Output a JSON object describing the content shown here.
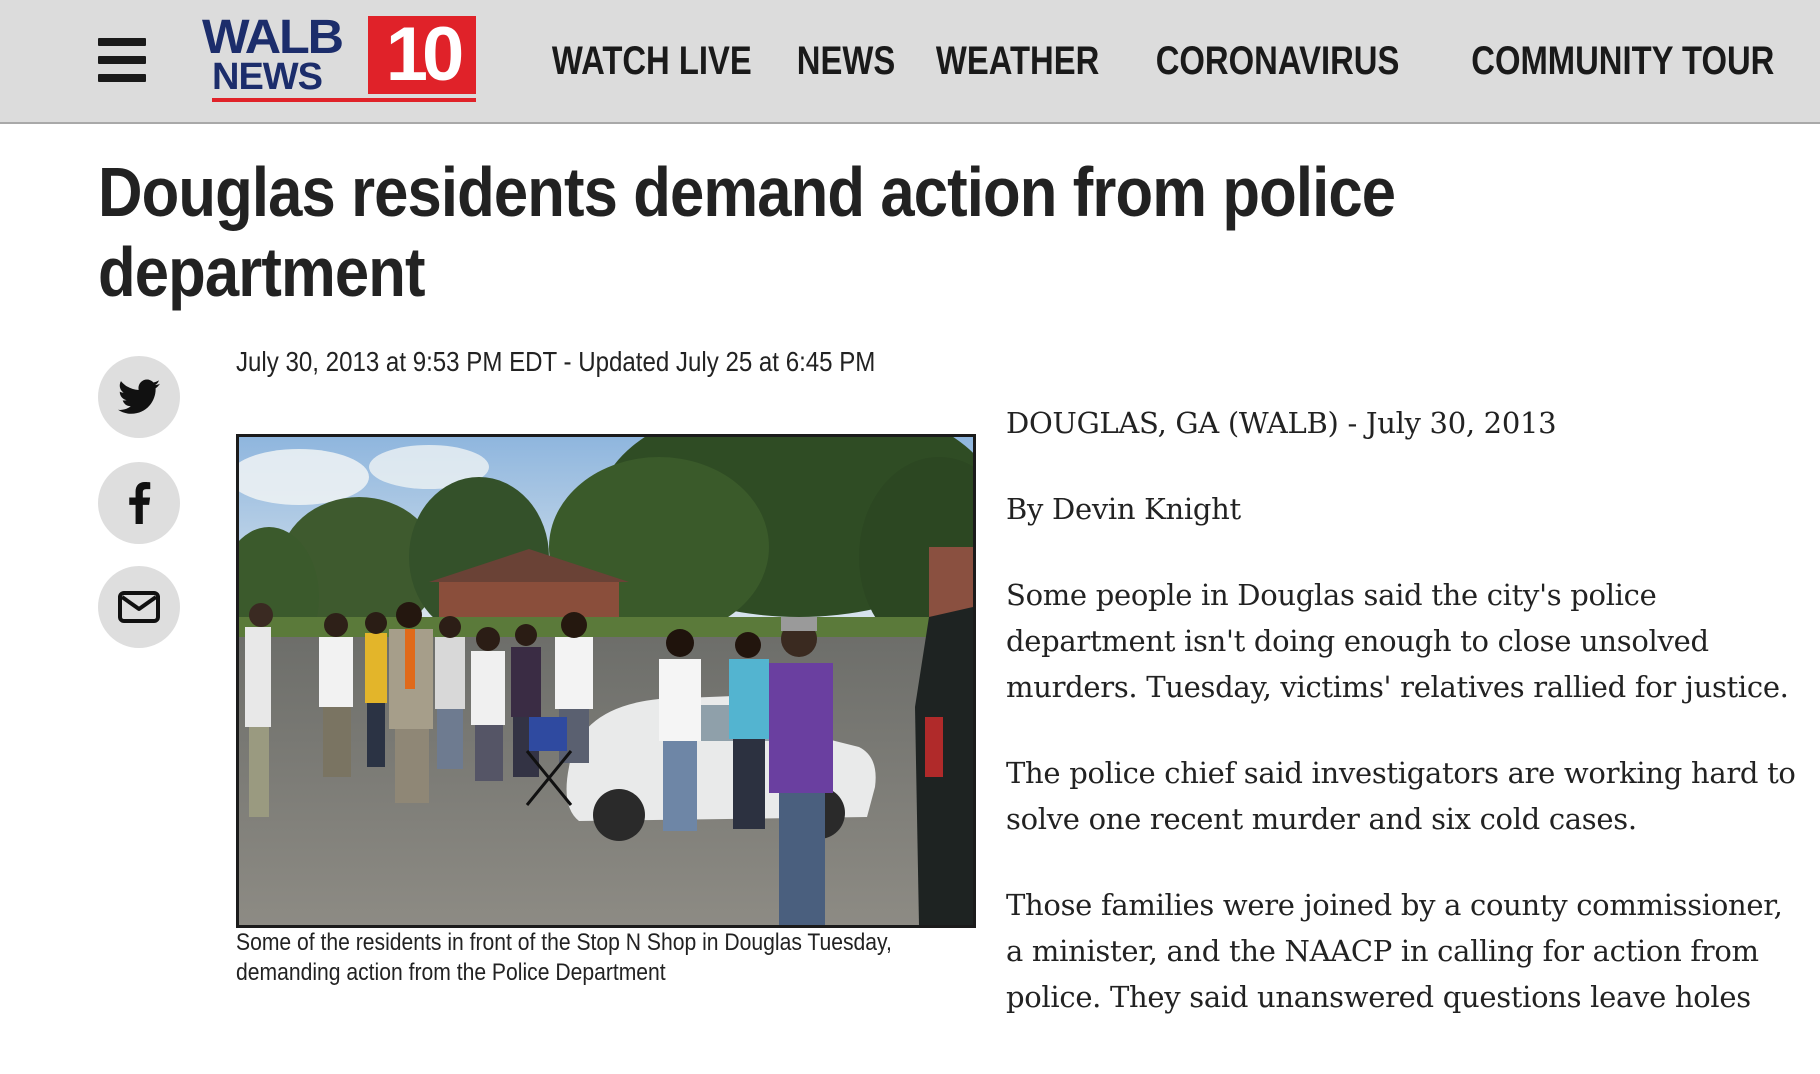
{
  "header": {
    "menu_icon": "hamburger-menu-icon",
    "logo": {
      "top_text": "WALB",
      "bottom_text": "NEWS",
      "number": "10",
      "colors": {
        "navy": "#1c2d6b",
        "red": "#e02229"
      }
    },
    "nav": [
      "WATCH LIVE",
      "NEWS",
      "WEATHER",
      "CORONAVIRUS",
      "COMMUNITY TOUR"
    ]
  },
  "article": {
    "headline": "Douglas residents demand action from police department",
    "timestamp": "July 30, 2013 at 9:53 PM EDT - Updated July 25 at 6:45 PM",
    "share": [
      {
        "name": "twitter",
        "icon": "twitter-icon"
      },
      {
        "name": "facebook",
        "icon": "facebook-icon"
      },
      {
        "name": "email",
        "icon": "email-icon"
      }
    ],
    "photo_caption": "Some of the residents in front of the Stop N Shop in Douglas Tuesday, demanding action from the Police Department",
    "dateline": "DOUGLAS, GA (WALB) - July 30, 2013",
    "byline": "By Devin Knight",
    "paragraphs": [
      "Some people in Douglas said the city's police department isn't doing enough to close unsolved murders.  Tuesday, victims' relatives rallied for justice.",
      "The police chief said investigators are working hard to solve one recent murder and six cold cases.",
      "Those families were joined by a county commissioner, a minister, and the NAACP in calling for action from police.  They said unanswered questions leave holes"
    ]
  }
}
